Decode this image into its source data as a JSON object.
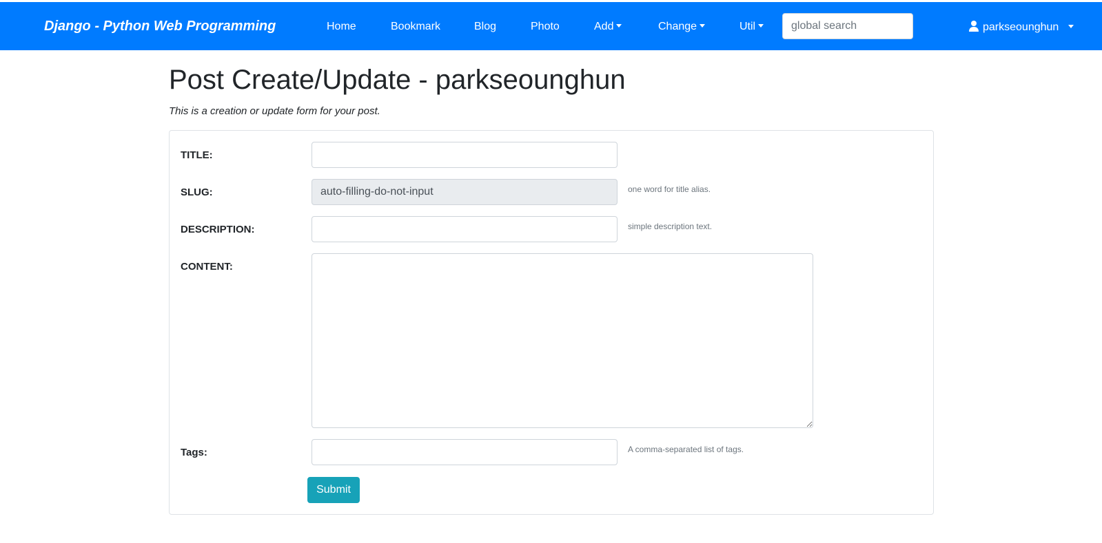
{
  "navbar": {
    "brand": "Django - Python Web Programming",
    "links": [
      {
        "label": "Home"
      },
      {
        "label": "Bookmark"
      },
      {
        "label": "Blog"
      },
      {
        "label": "Photo"
      },
      {
        "label": "Add",
        "dropdown": true
      },
      {
        "label": "Change",
        "dropdown": true
      },
      {
        "label": "Util",
        "dropdown": true
      }
    ],
    "search_placeholder": "global search",
    "user": {
      "name": "parkseounghun",
      "icon": "user-icon"
    },
    "color": "#007bff"
  },
  "page": {
    "title": "Post Create/Update - parkseounghun",
    "subtitle": "This is a creation or update form for your post."
  },
  "form": {
    "title": {
      "label": "TITLE:",
      "value": ""
    },
    "slug": {
      "label": "SLUG:",
      "value": "auto-filling-do-not-input",
      "help": "one word for title alias."
    },
    "description": {
      "label": "DESCRIPTION:",
      "value": "",
      "help": "simple description text."
    },
    "content": {
      "label": "CONTENT:",
      "value": ""
    },
    "tags": {
      "label": "Tags:",
      "value": "",
      "help": "A comma-separated list of tags."
    },
    "submit_label": "Submit",
    "submit_color": "#17a2b8"
  }
}
